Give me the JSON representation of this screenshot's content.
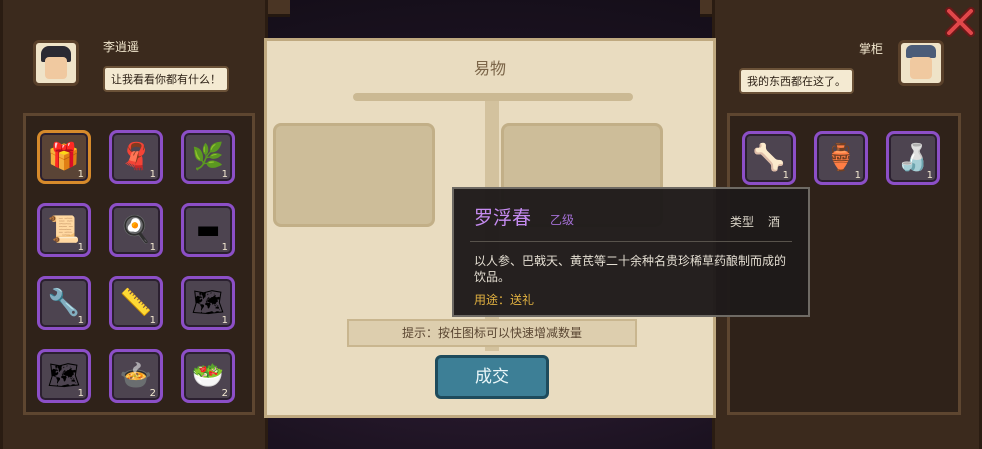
{
  "left_panel": {
    "speaker": "李逍遥",
    "bubble": "让我看看你都有什么！",
    "items": [
      {
        "icon": "treasure-chest-icon",
        "glyph": "🎁",
        "count": "1",
        "rarity": "orange"
      },
      {
        "icon": "cloth-icon",
        "glyph": "🧣",
        "count": "1",
        "rarity": "purple"
      },
      {
        "icon": "herb-icon",
        "glyph": "🌿",
        "count": "1",
        "rarity": "purple"
      },
      {
        "icon": "scroll-icon",
        "glyph": "📜",
        "count": "1",
        "rarity": "purple"
      },
      {
        "icon": "iron-pan-icon",
        "glyph": "🍳",
        "count": "1",
        "rarity": "purple"
      },
      {
        "icon": "iron-bar-icon",
        "glyph": "▬",
        "count": "1",
        "rarity": "purple"
      },
      {
        "icon": "pipe-icon",
        "glyph": "🔧",
        "count": "1",
        "rarity": "purple"
      },
      {
        "icon": "ruler-icon",
        "glyph": "📏",
        "count": "1",
        "rarity": "purple"
      },
      {
        "icon": "map-icon",
        "glyph": "🗺",
        "count": "1",
        "rarity": "purple"
      },
      {
        "icon": "map-icon",
        "glyph": "🗺",
        "count": "1",
        "rarity": "purple"
      },
      {
        "icon": "meat-dish-icon",
        "glyph": "🍲",
        "count": "2",
        "rarity": "purple"
      },
      {
        "icon": "vegetable-dish-icon",
        "glyph": "🥗",
        "count": "2",
        "rarity": "purple"
      }
    ]
  },
  "right_panel": {
    "speaker": "掌柜",
    "bubble": "我的东西都在这了。",
    "items": [
      {
        "icon": "bone-icon",
        "glyph": "🦴",
        "count": "1",
        "rarity": "purple"
      },
      {
        "icon": "wine-jar-icon",
        "glyph": "🏺",
        "count": "1",
        "rarity": "purple"
      },
      {
        "icon": "wine-bottle-icon",
        "glyph": "🍶",
        "count": "1",
        "rarity": "purple"
      }
    ]
  },
  "center": {
    "title": "易物",
    "hint": "提示：按住图标可以快速增减数量",
    "deal_button": "成交"
  },
  "tooltip": {
    "name": "罗浮春",
    "grade": "乙级",
    "type_label": "类型",
    "type_value": "酒",
    "description": "以人参、巴戟天、黄芪等二十余种名贵珍稀草药酿制而成的饮品。",
    "usage": "用途：送礼"
  },
  "colors": {
    "rare_border": "#8c4fc7",
    "epic_border": "#d68a2b",
    "deal_button": "#3d7f96",
    "tooltip_name": "#c58bf0",
    "usage_text": "#e0b040"
  }
}
